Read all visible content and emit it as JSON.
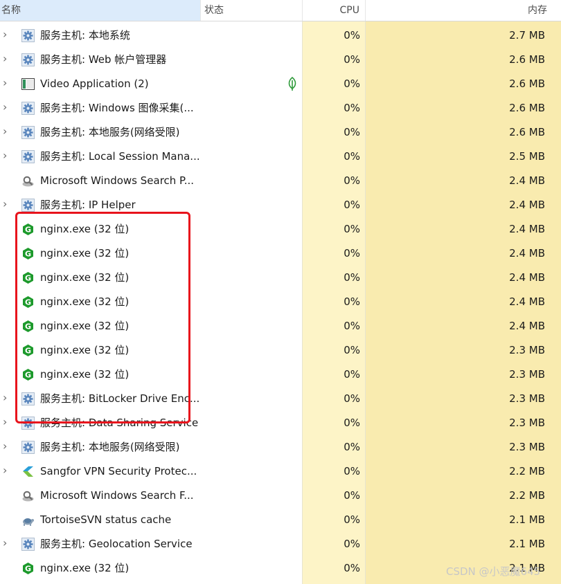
{
  "columns": {
    "name": "名称",
    "status": "状态",
    "cpu": "CPU",
    "memory": "内存"
  },
  "rows": [
    {
      "name": "服务主机: 本地系统",
      "icon": "gear-icon",
      "expandable": true,
      "cpu": "0%",
      "mem": "2.7 MB"
    },
    {
      "name": "服务主机: Web 帐户管理器",
      "icon": "gear-icon",
      "expandable": true,
      "cpu": "0%",
      "mem": "2.6 MB"
    },
    {
      "name": "Video Application (2)",
      "icon": "video-app-icon",
      "expandable": true,
      "status_icon": "leaf-icon",
      "cpu": "0%",
      "mem": "2.6 MB"
    },
    {
      "name": "服务主机: Windows 图像采集(...",
      "icon": "gear-icon",
      "expandable": true,
      "cpu": "0%",
      "mem": "2.6 MB"
    },
    {
      "name": "服务主机: 本地服务(网络受限)",
      "icon": "gear-icon",
      "expandable": true,
      "cpu": "0%",
      "mem": "2.6 MB"
    },
    {
      "name": "服务主机: Local Session Mana...",
      "icon": "gear-icon",
      "expandable": true,
      "cpu": "0%",
      "mem": "2.5 MB"
    },
    {
      "name": "Microsoft Windows Search P...",
      "icon": "search-indexer-icon",
      "expandable": false,
      "cpu": "0%",
      "mem": "2.4 MB"
    },
    {
      "name": "服务主机: IP Helper",
      "icon": "gear-icon",
      "expandable": true,
      "cpu": "0%",
      "mem": "2.4 MB"
    },
    {
      "name": "nginx.exe (32 位)",
      "icon": "nginx-icon",
      "expandable": false,
      "cpu": "0%",
      "mem": "2.4 MB"
    },
    {
      "name": "nginx.exe (32 位)",
      "icon": "nginx-icon",
      "expandable": false,
      "cpu": "0%",
      "mem": "2.4 MB"
    },
    {
      "name": "nginx.exe (32 位)",
      "icon": "nginx-icon",
      "expandable": false,
      "cpu": "0%",
      "mem": "2.4 MB"
    },
    {
      "name": "nginx.exe (32 位)",
      "icon": "nginx-icon",
      "expandable": false,
      "cpu": "0%",
      "mem": "2.4 MB"
    },
    {
      "name": "nginx.exe (32 位)",
      "icon": "nginx-icon",
      "expandable": false,
      "cpu": "0%",
      "mem": "2.4 MB"
    },
    {
      "name": "nginx.exe (32 位)",
      "icon": "nginx-icon",
      "expandable": false,
      "cpu": "0%",
      "mem": "2.3 MB"
    },
    {
      "name": "nginx.exe (32 位)",
      "icon": "nginx-icon",
      "expandable": false,
      "cpu": "0%",
      "mem": "2.3 MB"
    },
    {
      "name": "服务主机: BitLocker Drive Enc...",
      "icon": "gear-icon",
      "expandable": true,
      "cpu": "0%",
      "mem": "2.3 MB"
    },
    {
      "name": "服务主机: Data Sharing Service",
      "icon": "gear-icon",
      "expandable": true,
      "cpu": "0%",
      "mem": "2.3 MB"
    },
    {
      "name": "服务主机: 本地服务(网络受限)",
      "icon": "gear-icon",
      "expandable": true,
      "cpu": "0%",
      "mem": "2.3 MB"
    },
    {
      "name": "Sangfor VPN Security Protec...",
      "icon": "sangfor-icon",
      "expandable": true,
      "cpu": "0%",
      "mem": "2.2 MB"
    },
    {
      "name": "Microsoft Windows Search F...",
      "icon": "search-indexer-icon",
      "expandable": false,
      "cpu": "0%",
      "mem": "2.2 MB"
    },
    {
      "name": "TortoiseSVN status cache",
      "icon": "tortoise-icon",
      "expandable": false,
      "cpu": "0%",
      "mem": "2.1 MB"
    },
    {
      "name": "服务主机: Geolocation Service",
      "icon": "gear-icon",
      "expandable": true,
      "cpu": "0%",
      "mem": "2.1 MB"
    },
    {
      "name": "nginx.exe (32 位)",
      "icon": "nginx-icon",
      "expandable": false,
      "cpu": "0%",
      "mem": "2.1 MB"
    }
  ],
  "watermark": "CSDN @小恶魔645",
  "colors": {
    "header_selected": "#dcebfb",
    "cpu_column": "#fdf4c7",
    "memory_column": "#f9ebaf",
    "highlight_box": "#e8131c",
    "nginx_green": "#1d9a2c"
  }
}
